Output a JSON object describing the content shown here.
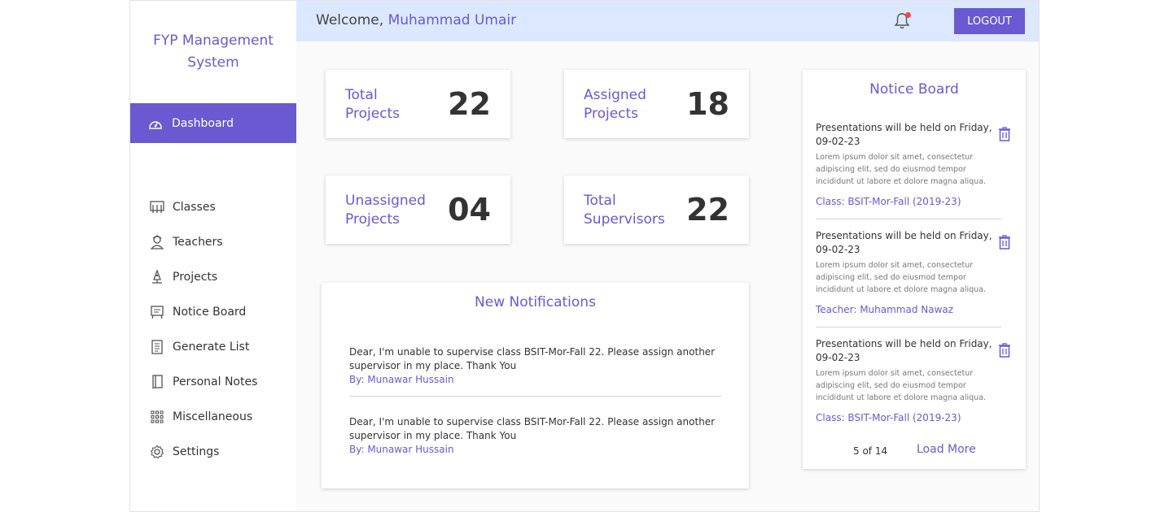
{
  "brand": {
    "line1": "FYP Management",
    "line2": "System"
  },
  "sidebar": {
    "active": {
      "label": "Dashboard",
      "icon": "dashboard-icon"
    },
    "items": [
      {
        "label": "Classes",
        "icon": "classroom-icon"
      },
      {
        "label": "Teachers",
        "icon": "teacher-icon"
      },
      {
        "label": "Projects",
        "icon": "rocket-icon"
      },
      {
        "label": "Notice Board",
        "icon": "notice-board-icon"
      },
      {
        "label": "Generate List",
        "icon": "list-document-icon"
      },
      {
        "label": "Personal Notes",
        "icon": "notebook-icon"
      },
      {
        "label": "Miscellaneous",
        "icon": "grid-icon"
      },
      {
        "label": "Settings",
        "icon": "gear-icon"
      }
    ]
  },
  "header": {
    "welcome": "Welcome,",
    "user": "Muhammad Umair",
    "logout": "LOGOUT"
  },
  "stats": [
    {
      "line1": "Total",
      "line2": "Projects",
      "value": "22"
    },
    {
      "line1": "Assigned",
      "line2": "Projects",
      "value": "18"
    },
    {
      "line1": "Unassigned",
      "line2": "Projects",
      "value": "04"
    },
    {
      "line1": "Total",
      "line2": "Supervisors",
      "value": "22"
    }
  ],
  "notifications": {
    "title": "New Notifications",
    "items": [
      {
        "text": "Dear, I'm unable to supervise class BSIT-Mor-Fall 22. Please assign another supervisor in my place. Thank You",
        "by": "By: Munawar Hussain"
      },
      {
        "text": "Dear, I'm unable to supervise class BSIT-Mor-Fall 22. Please assign another supervisor in my place. Thank You",
        "by": "By: Munawar Hussain"
      }
    ]
  },
  "notice_board": {
    "title": "Notice Board",
    "items": [
      {
        "heading": "Presentations will be held on Friday, 09-02-23",
        "body": "Lorem ipsum dolor sit amet, consectetur adipiscing elit, sed do eiusmod tempor incididunt ut labore et dolore magna aliqua.",
        "meta": "Class: BSIT-Mor-Fall (2019-23)"
      },
      {
        "heading": "Presentations will be held on Friday, 09-02-23",
        "body": "Lorem ipsum dolor sit amet, consectetur adipiscing elit, sed do eiusmod tempor incididunt ut labore et dolore magna aliqua.",
        "meta": "Teacher: Muhammad Nawaz"
      },
      {
        "heading": "Presentations will be held on Friday, 09-02-23",
        "body": "Lorem ipsum dolor sit amet, consectetur adipiscing elit, sed do eiusmod tempor incididunt ut labore et dolore magna aliqua.",
        "meta": "Class: BSIT-Mor-Fall (2019-23)"
      }
    ],
    "pager": "5 of 14",
    "load_more": "Load More"
  },
  "colors": {
    "accent": "#6a59d1",
    "header_bg": "#dce8ff",
    "notify_dot": "#f0483e"
  }
}
